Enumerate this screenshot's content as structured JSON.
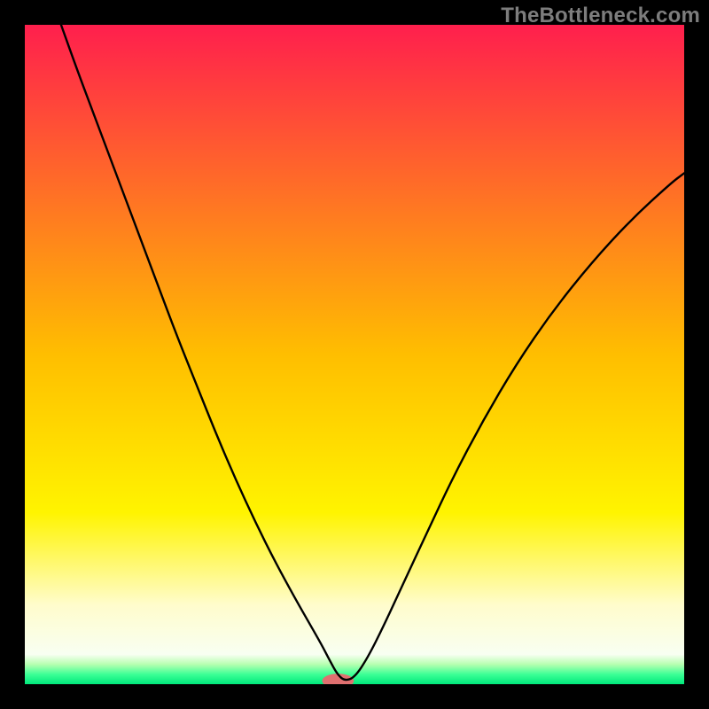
{
  "watermark": "TheBottleneck.com",
  "chart_data": {
    "type": "line",
    "title": "",
    "xlabel": "",
    "ylabel": "",
    "xlim": [
      0,
      1
    ],
    "ylim": [
      0,
      1
    ],
    "grid": false,
    "legend": false,
    "background_gradient_stops": [
      {
        "offset": 0.0,
        "color": "#ff1f4d"
      },
      {
        "offset": 0.5,
        "color": "#ffbe00"
      },
      {
        "offset": 0.74,
        "color": "#fff400"
      },
      {
        "offset": 0.88,
        "color": "#fffccc"
      },
      {
        "offset": 0.955,
        "color": "#f8fff2"
      },
      {
        "offset": 0.97,
        "color": "#b6ffb0"
      },
      {
        "offset": 0.985,
        "color": "#3dff96"
      },
      {
        "offset": 1.0,
        "color": "#00e87b"
      }
    ],
    "notch_marker": {
      "x": 0.475,
      "y": 0.995,
      "color": "#e07070",
      "rx": 0.024,
      "ry": 0.011
    },
    "series": [
      {
        "name": "curve",
        "color": "#000000",
        "x": [
          0.055,
          0.08,
          0.11,
          0.14,
          0.17,
          0.2,
          0.23,
          0.26,
          0.29,
          0.32,
          0.35,
          0.38,
          0.41,
          0.43,
          0.45,
          0.463,
          0.474,
          0.485,
          0.5,
          0.52,
          0.545,
          0.575,
          0.61,
          0.65,
          0.695,
          0.745,
          0.8,
          0.86,
          0.92,
          0.98,
          1.0
        ],
        "y": [
          1.0,
          0.93,
          0.85,
          0.77,
          0.69,
          0.61,
          0.53,
          0.455,
          0.38,
          0.31,
          0.245,
          0.185,
          0.13,
          0.095,
          0.06,
          0.035,
          0.015,
          0.005,
          0.01,
          0.04,
          0.09,
          0.155,
          0.23,
          0.315,
          0.4,
          0.485,
          0.565,
          0.64,
          0.705,
          0.76,
          0.775
        ]
      }
    ]
  }
}
